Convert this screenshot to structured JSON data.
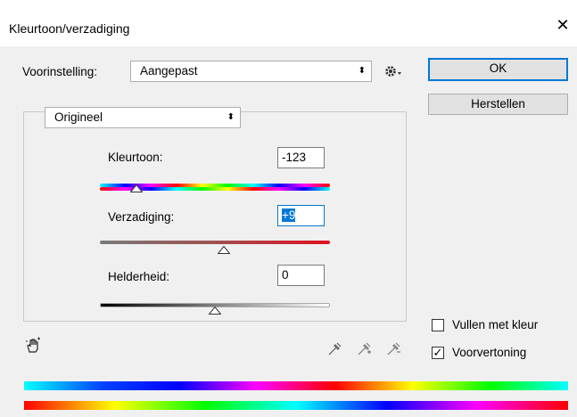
{
  "window": {
    "title": "Kleurtoon/verzadiging"
  },
  "preset": {
    "label": "Voorinstelling:",
    "value": "Aangepast"
  },
  "buttons": {
    "ok": "OK",
    "reset": "Herstellen"
  },
  "channel": {
    "value": "Origineel"
  },
  "hue": {
    "label": "Kleurtoon:",
    "value": "-123",
    "position": 0.16
  },
  "saturation": {
    "label": "Verzadiging:",
    "value": "+9",
    "position": 0.54
  },
  "lightness": {
    "label": "Helderheid:",
    "value": "0",
    "position": 0.5
  },
  "options": {
    "colorize_label": "Vullen met kleur",
    "colorize_checked": false,
    "preview_label": "Voorvertoning",
    "preview_checked": true
  },
  "colors": {
    "accent": "#0078d7",
    "focus_select": "#0078d7"
  }
}
